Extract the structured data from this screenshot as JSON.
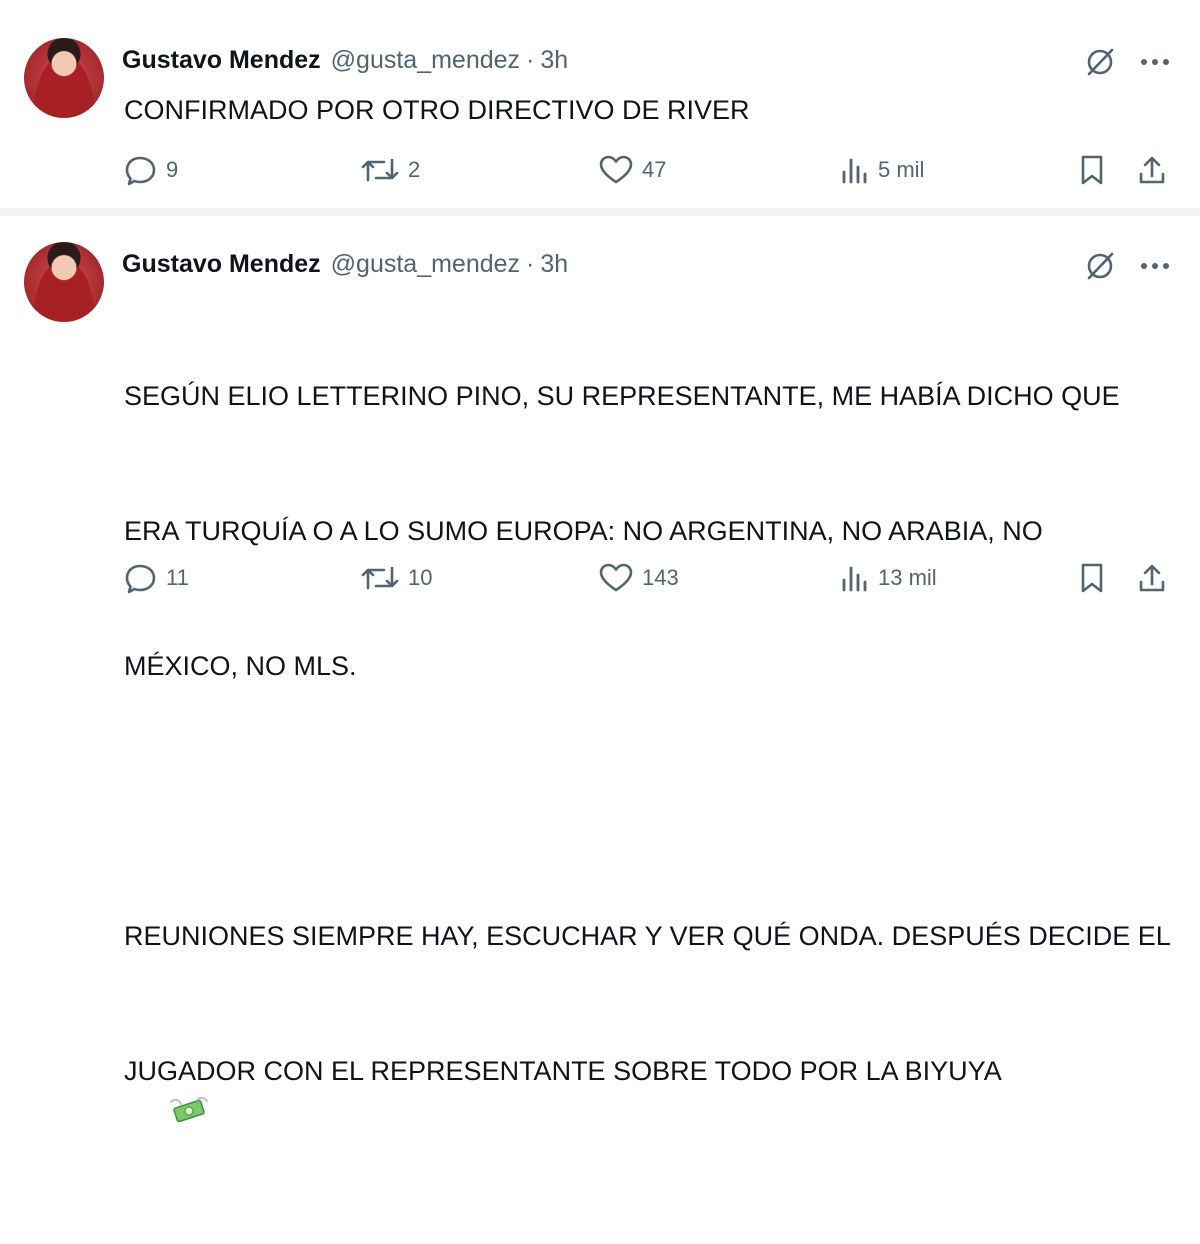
{
  "tweets": [
    {
      "author_name": "Gustavo Mendez",
      "handle": "@gusta_mendez",
      "separator": "·",
      "time": "3h",
      "text": "CONFIRMADO POR OTRO DIRECTIVO DE RIVER",
      "replies": "9",
      "retweets": "2",
      "likes": "47",
      "views": "5 mil"
    },
    {
      "author_name": "Gustavo Mendez",
      "handle": "@gusta_mendez",
      "separator": "·",
      "time": "3h",
      "text_line_1": "SEGÚN ELIO LETTERINO PINO, SU REPRESENTANTE, ME HABÍA DICHO QUE",
      "text_line_2": "ERA TURQUÍA O A LO SUMO EUROPA: NO ARGENTINA, NO ARABIA, NO",
      "text_line_3": "MÉXICO, NO MLS.",
      "text_line_4": "REUNIONES SIEMPRE HAY, ESCUCHAR Y VER QUÉ ONDA. DESPUÉS DECIDE EL",
      "text_line_5": "JUGADOR CON EL REPRESENTANTE SOBRE TODO POR LA BIYUYA",
      "emoji": "money-with-wings-emoji",
      "replies": "11",
      "retweets": "10",
      "likes": "143",
      "views": "13 mil"
    }
  ],
  "colors": {
    "text": "#0f1419",
    "secondary": "#536471",
    "divider": "#eff3f4"
  },
  "icons": [
    "reply-icon",
    "retweet-icon",
    "like-icon",
    "views-icon",
    "bookmark-icon",
    "share-icon",
    "grok-icon",
    "more-icon"
  ]
}
